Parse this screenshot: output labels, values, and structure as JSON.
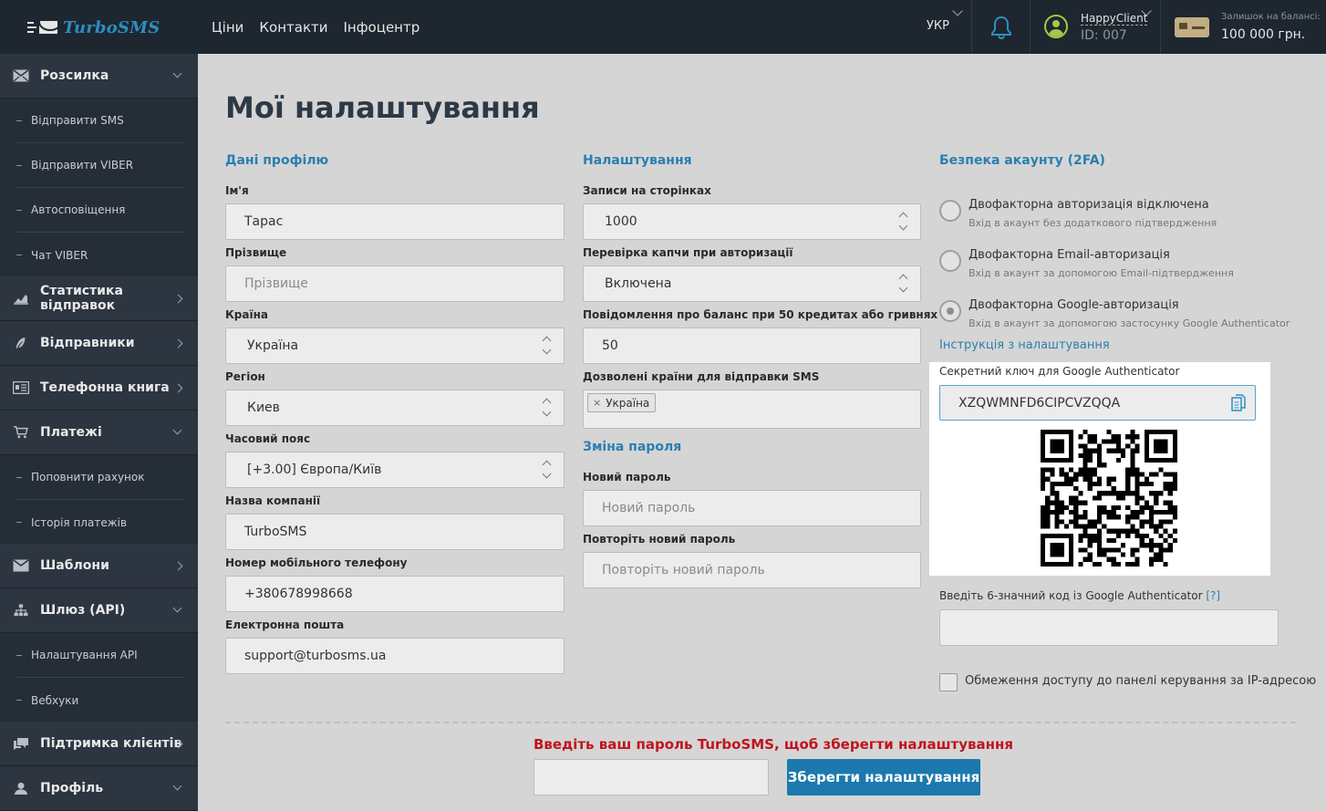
{
  "app": {
    "brand": "TurboSMS"
  },
  "topnav": [
    "Ціни",
    "Контакти",
    "Інфоцентр"
  ],
  "header": {
    "lang": "УКР",
    "user_name": "HappyClient",
    "user_id": "ID: 007",
    "balance_label": "Залишок на балансі:",
    "balance_value": "100 000 грн."
  },
  "sidebar": {
    "sections": [
      {
        "label": "Розсилка",
        "icon": "envelope-icon",
        "expanded": true,
        "items": [
          "Відправити SMS",
          "Відправити VIBER",
          "Автосповіщення",
          "Чат VIBER"
        ]
      },
      {
        "label": "Статистика відправок",
        "icon": "chart-icon",
        "expanded": false
      },
      {
        "label": "Відправники",
        "icon": "feather-icon",
        "expanded": false
      },
      {
        "label": "Телефонна книга",
        "icon": "address-book-icon",
        "expanded": false
      },
      {
        "label": "Платежі",
        "icon": "cart-icon",
        "expanded": true,
        "items": [
          "Поповнити рахунок",
          "Історія платежів"
        ]
      },
      {
        "label": "Шаблони",
        "icon": "envelope-icon",
        "expanded": false
      },
      {
        "label": "Шлюз (API)",
        "icon": "network-icon",
        "expanded": true,
        "items": [
          "Налаштування API",
          "Вебхуки"
        ]
      },
      {
        "label": "Підтримка клієнтів",
        "icon": "chat-icon",
        "expanded": false
      },
      {
        "label": "Профіль",
        "icon": "user-icon",
        "expanded": true
      }
    ]
  },
  "page": {
    "title": "Мої налаштування"
  },
  "profile": {
    "title": "Дані профілю",
    "name_label": "Ім'я",
    "name_value": "Тарас",
    "surname_label": "Прізвище",
    "surname_placeholder": "Прізвище",
    "country_label": "Країна",
    "country_value": "Україна",
    "region_label": "Регіон",
    "region_value": "Киев",
    "tz_label": "Часовий пояс",
    "tz_value": "[+3.00] Європа/Київ",
    "company_label": "Назва компанії",
    "company_value": "TurboSMS",
    "phone_label": "Номер мобільного телефону",
    "phone_value": "+380678998668",
    "email_label": "Електронна пошта",
    "email_value": "support@turbosms.ua"
  },
  "settings": {
    "title": "Налаштування",
    "records_label": "Записи на сторінках",
    "records_value": "1000",
    "captcha_label": "Перевірка капчи при авторизації",
    "captcha_value": "Включена",
    "balance_notice_label": "Повідомлення про баланс при 50 кредитах або гривнях",
    "balance_notice_value": "50",
    "countries_label": "Дозволені країни для відправки SMS",
    "countries_tag": "Україна",
    "tag_remove": "×",
    "password_title": "Зміна пароля",
    "new_pwd_label": "Новий пароль",
    "new_pwd_placeholder": "Новий пароль",
    "repeat_pwd_label": "Повторіть новий пароль",
    "repeat_pwd_placeholder": "Повторіть новий пароль"
  },
  "security": {
    "title": "Безпека акаунту (2FA)",
    "options": [
      {
        "label": "Двофакторна авторизація відключена",
        "sub": "Вхід в акаунт без додаткового підтвердження",
        "checked": false
      },
      {
        "label": "Двофакторна Email-авторизація",
        "sub": "Вхід в акаунт за допомогою Email-підтвердження",
        "checked": false
      },
      {
        "label": "Двофакторна Google-авторизація",
        "sub": "Вхід в акаунт за допомогою застосунку Google Authenticator",
        "checked": true
      }
    ],
    "instruction_link": "Інструкція з налаштування",
    "secret_label": "Секретний ключ для Google Authenticator",
    "secret_value": "XZQWMNFD6CIPCVZQQA",
    "code_label": "Введіть 6-значний код із Google Authenticator",
    "code_help": "[?]",
    "ip_label": "Обмеження доступу до панелі керування за IP-адресою"
  },
  "footer": {
    "warning": "Введіть ваш пароль TurboSMS, щоб зберегти налаштування",
    "save_label": "Зберегти налаштування"
  },
  "colors": {
    "accent": "#2a7fb0",
    "button": "#1c79ad",
    "warning": "#c0141c",
    "sidebar": "#252e37",
    "topbar": "#1e262f"
  }
}
